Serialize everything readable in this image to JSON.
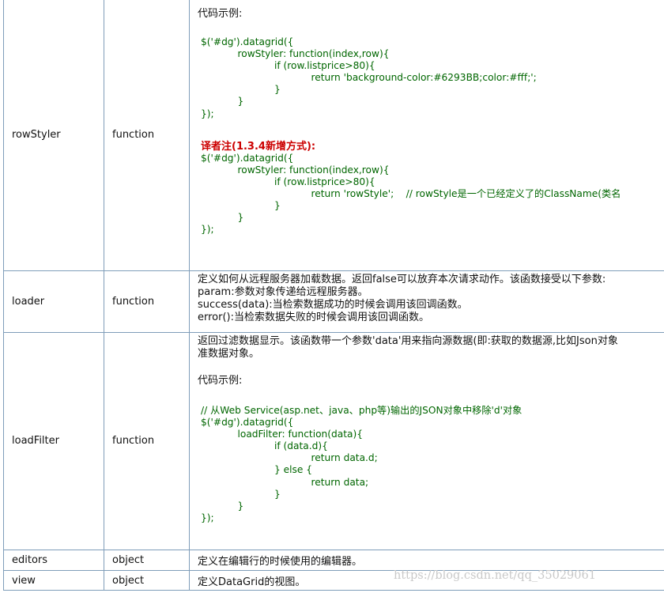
{
  "rows": [
    {
      "name": "rowStyler",
      "type": "function",
      "label": "代码示例:",
      "code1": "$('#dg').datagrid({\n            rowStyler: function(index,row){\n                        if (row.listprice>80){\n                                    return 'background-color:#6293BB;color:#fff;';\n                        }\n            }\n});",
      "note": "译者注(1.3.4新增方式):",
      "code2": "$('#dg').datagrid({\n            rowStyler: function(index,row){\n                        if (row.listprice>80){\n                                    return 'rowStyle';    // rowStyle是一个已经定义了的ClassName(类名\n                        }\n            }\n});"
    },
    {
      "name": "loader",
      "type": "function",
      "desc": "定义如何从远程服务器加载数据。返回false可以放弃本次请求动作。该函数接受以下参数:\nparam:参数对象传递给远程服务器。\nsuccess(data):当检索数据成功的时候会调用该回调函数。\nerror():当检索数据失败的时候会调用该回调函数。"
    },
    {
      "name": "loadFilter",
      "type": "function",
      "desc": "返回过滤数据显示。该函数带一个参数'data'用来指向源数据(即:获取的数据源,比如Json对象\n准数据对象。",
      "label": "代码示例:",
      "code": "// 从Web Service(asp.net、java、php等)输出的JSON对象中移除'd'对象\n$('#dg').datagrid({\n            loadFilter: function(data){\n                        if (data.d){\n                                    return data.d;\n                        } else {\n                                    return data;\n                        }\n            }\n});"
    },
    {
      "name": "editors",
      "type": "object",
      "desc": "定义在编辑行的时候使用的编辑器。"
    },
    {
      "name": "view",
      "type": "object",
      "desc": "定义DataGrid的视图。"
    }
  ],
  "watermark": "https://blog.csdn.net/qq_35029061"
}
